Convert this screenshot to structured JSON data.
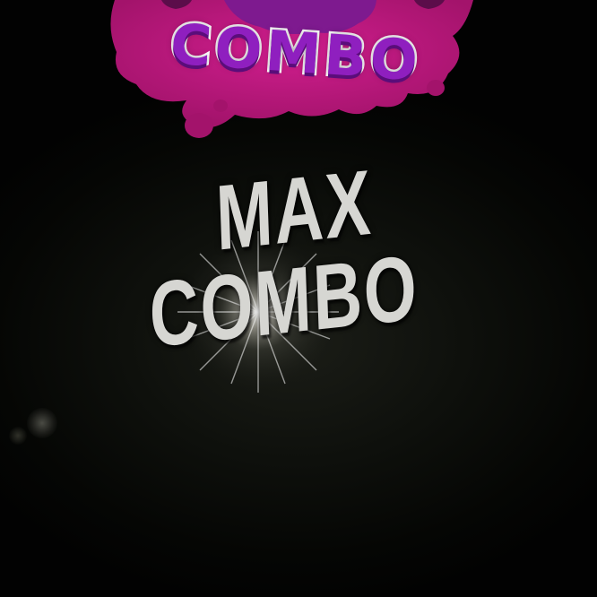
{
  "badge": {
    "label": "COMBO",
    "fill_color": "#8f1fbf",
    "splash_color": "#c0187f",
    "outline_color": "#ffffff"
  },
  "title": {
    "line1": "MAX",
    "line2": "COMBO",
    "color": "#d6d6d2"
  },
  "background_color": "#0e100c"
}
